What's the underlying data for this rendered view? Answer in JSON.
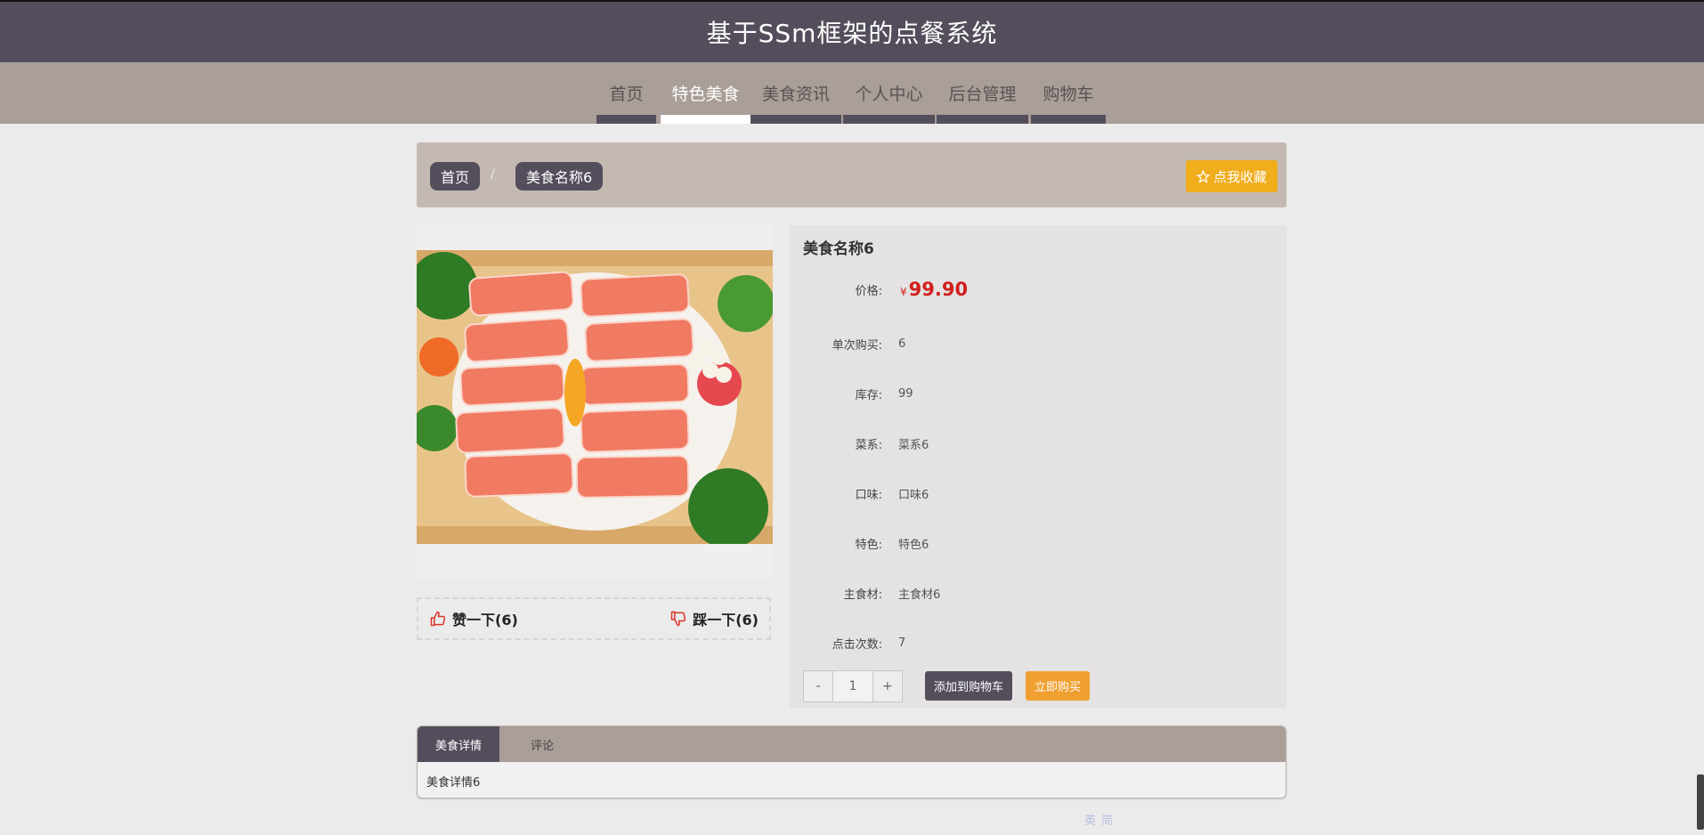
{
  "header": {
    "title": "基于SSm框架的点餐系统"
  },
  "nav": {
    "items": [
      {
        "label": "首页"
      },
      {
        "label": "特色美食"
      },
      {
        "label": "美食资讯"
      },
      {
        "label": "个人中心"
      },
      {
        "label": "后台管理"
      },
      {
        "label": "购物车"
      }
    ],
    "active": "特色美食"
  },
  "breadcrumb": {
    "home": "首页",
    "separator": "/",
    "current": "美食名称6",
    "favorite_label": "点我收藏"
  },
  "product": {
    "name": "美食名称6",
    "price_label": "价格:",
    "currency": "¥",
    "price": "99.90",
    "fields": [
      {
        "label": "单次购买:",
        "value": "6"
      },
      {
        "label": "库存:",
        "value": "99"
      },
      {
        "label": "菜系:",
        "value": "菜系6"
      },
      {
        "label": "口味:",
        "value": "口味6"
      },
      {
        "label": "特色:",
        "value": "特色6"
      },
      {
        "label": "主食材:",
        "value": "主食材6"
      },
      {
        "label": "点击次数:",
        "value": "7"
      }
    ],
    "quantity": {
      "minus": "-",
      "value": "1",
      "plus": "+"
    },
    "add_to_cart_label": "添加到购物车",
    "buy_now_label": "立即购买"
  },
  "votes": {
    "like_label": "赞一下(6)",
    "dislike_label": "踩一下(6)"
  },
  "tabs": {
    "items": [
      {
        "label": "美食详情"
      },
      {
        "label": "评论"
      }
    ],
    "content": "美食详情6"
  },
  "tray": [
    "英",
    "简"
  ],
  "colors": {
    "header_bg": "#544e5c",
    "nav_bg": "#a99e98",
    "breadcrumb_bg": "#c4b9b2",
    "favorite_btn": "#f0ad1c",
    "buy_btn": "#f0a030",
    "price": "#d21f1f"
  },
  "icons": {
    "favorite": "star-icon",
    "like": "thumbs-up-icon",
    "dislike": "thumbs-down-icon"
  }
}
